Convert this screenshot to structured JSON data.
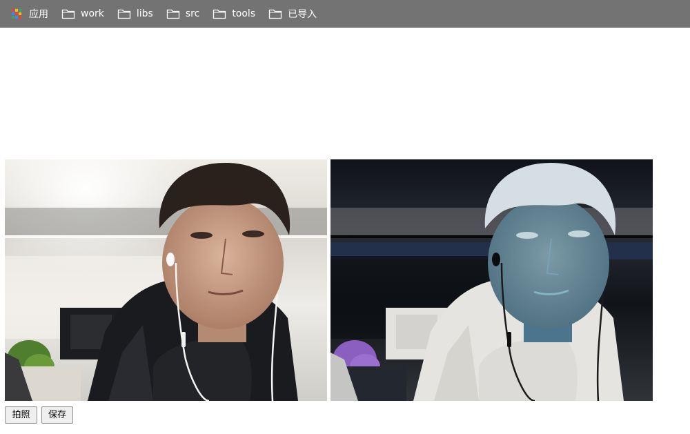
{
  "bookmarks": [
    {
      "label": "应用",
      "icon": "apps-grid-icon"
    },
    {
      "label": "work",
      "icon": "folder-icon"
    },
    {
      "label": "libs",
      "icon": "folder-icon"
    },
    {
      "label": "src",
      "icon": "folder-icon"
    },
    {
      "label": "tools",
      "icon": "folder-icon"
    },
    {
      "label": "已导入",
      "icon": "folder-icon"
    }
  ],
  "camera": {
    "left_view": "webcam-live-feed",
    "right_view": "inverted-filter-output"
  },
  "actions": {
    "capture_label": "拍照",
    "save_label": "保存"
  },
  "colors": {
    "bookmarks_bar_bg": "#737373",
    "page_bg": "#ffffff",
    "button_bg": "#efefef"
  }
}
